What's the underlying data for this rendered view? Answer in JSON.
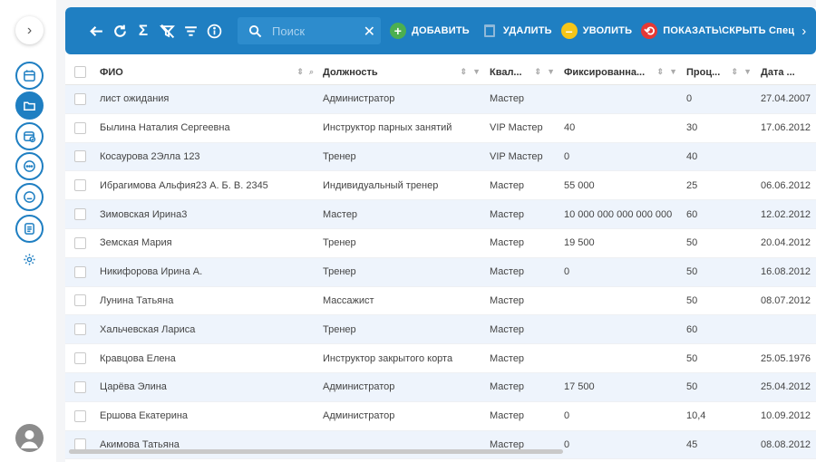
{
  "sidebar": {
    "toggle_icon": "chevron-right-icon",
    "items": [
      {
        "icon": "calendar-icon",
        "active": false
      },
      {
        "icon": "folder-icon",
        "active": true
      },
      {
        "icon": "calendar-check-icon",
        "active": false
      },
      {
        "icon": "chat-icon",
        "active": false
      },
      {
        "icon": "minus-circle-icon",
        "active": false
      },
      {
        "icon": "document-icon",
        "active": false
      },
      {
        "icon": "gear-icon",
        "active": false
      }
    ],
    "user_icon": "user-avatar-icon"
  },
  "toolbar": {
    "search_placeholder": "Поиск",
    "add_label": "ДОБАВИТЬ",
    "delete_label": "УДАЛИТЬ",
    "fire_label": "УВОЛИТЬ",
    "toggle_label": "ПОКАЗАТЬ\\СКРЫТЬ Спец"
  },
  "table": {
    "headers": {
      "name": "ФИО",
      "position": "Должность",
      "qualification": "Квал...",
      "fixed": "Фиксированна...",
      "percent": "Проц...",
      "date": "Дата ..."
    },
    "rows": [
      {
        "name": "лист ожидания",
        "position": "Администратор",
        "qualification": "Мастер",
        "fixed": "",
        "percent": "0",
        "date": "27.04.2007"
      },
      {
        "name": "Былина Наталия Сергеевна",
        "position": "Инструктор парных занятий",
        "qualification": "VIP Мастер",
        "fixed": "40",
        "percent": "30",
        "date": "17.06.2012"
      },
      {
        "name": "Косаурова 2Элла 123",
        "position": "Тренер",
        "qualification": "VIP Мастер",
        "fixed": "0",
        "percent": "40",
        "date": ""
      },
      {
        "name": "Ибрагимова Альфия23 А. Б. В. 2345",
        "position": "Индивидуальный тренер",
        "qualification": "Мастер",
        "fixed": "55 000",
        "percent": "25",
        "date": "06.06.2012"
      },
      {
        "name": "Зимовская Ирина3",
        "position": "Мастер",
        "qualification": "Мастер",
        "fixed": "10 000 000 000 000 000",
        "percent": "60",
        "date": "12.02.2012"
      },
      {
        "name": "Земская Мария",
        "position": "Тренер",
        "qualification": "Мастер",
        "fixed": "19 500",
        "percent": "50",
        "date": "20.04.2012"
      },
      {
        "name": "Никифорова Ирина А.",
        "position": "Тренер",
        "qualification": "Мастер",
        "fixed": "0",
        "percent": "50",
        "date": "16.08.2012"
      },
      {
        "name": "Лунина Татьяна",
        "position": "Массажист",
        "qualification": "Мастер",
        "fixed": "",
        "percent": "50",
        "date": "08.07.2012"
      },
      {
        "name": "Хальчевская Лариса",
        "position": "Тренер",
        "qualification": "Мастер",
        "fixed": "",
        "percent": "60",
        "date": ""
      },
      {
        "name": "Кравцова Елена",
        "position": "Инструктор закрытого корта",
        "qualification": "Мастер",
        "fixed": "",
        "percent": "50",
        "date": "25.05.1976"
      },
      {
        "name": "Царёва Элина",
        "position": "Администратор",
        "qualification": "Мастер",
        "fixed": "17 500",
        "percent": "50",
        "date": "25.04.2012"
      },
      {
        "name": "Ершова Екатерина",
        "position": "Администратор",
        "qualification": "Мастер",
        "fixed": "0",
        "percent": "10,4",
        "date": "10.09.2012"
      },
      {
        "name": "Акимова Татьяна",
        "position": "",
        "qualification": "Мастер",
        "fixed": "0",
        "percent": "45",
        "date": "08.08.2012"
      }
    ]
  }
}
